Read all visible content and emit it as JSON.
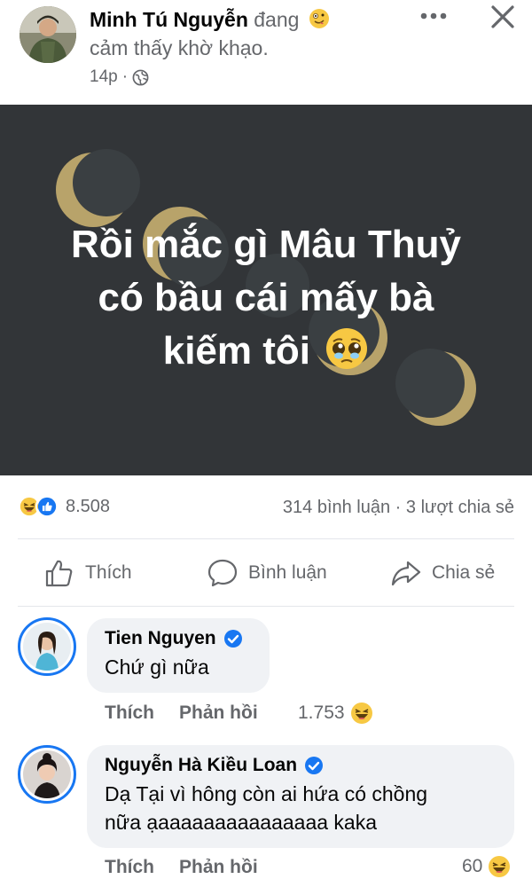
{
  "post": {
    "author": "Minh Tú Nguyễn",
    "feeling_prefix": "đang",
    "feeling_emoji": "zany-face-icon",
    "feeling_text": "cảm thấy khờ khạo.",
    "time": "14p",
    "privacy_separator": "·",
    "privacy_icon": "globe-icon",
    "image_text_lines": [
      "Rồi mắc gì Mâu Thuỷ",
      "có bầu cái mấy bà",
      "kiếm tôi"
    ],
    "image_emoji": "pleading-face-icon",
    "background_color": "#323538",
    "moon_color": "#b8a36a"
  },
  "reactions": {
    "icons": [
      "haha-icon",
      "like-icon"
    ],
    "count": "8.508",
    "comments_shares": "314 bình luận · 3 lượt chia sẻ"
  },
  "actions": {
    "like_label": "Thích",
    "comment_label": "Bình luận",
    "share_label": "Chia sẻ"
  },
  "comments": [
    {
      "name": "Tien Nguyen",
      "verified": true,
      "text": "Chứ gì nữa",
      "like_label": "Thích",
      "reply_label": "Phản hồi",
      "reaction_count": "1.753",
      "reaction_icon": "haha-icon"
    },
    {
      "name": "Nguyễn Hà Kiều Loan",
      "verified": true,
      "text_line1": "Dạ Tại vì hông còn ai hứa có chồng",
      "text_line2": "nữa ạaaaaaaaaaaaaaaa kaka",
      "like_label": "Thích",
      "reply_label": "Phản hồi",
      "reaction_count": "60",
      "reaction_icon": "haha-icon"
    }
  ],
  "colors": {
    "accent": "#1877f2",
    "secondary_text": "#65676b",
    "bubble": "#f0f2f5"
  }
}
